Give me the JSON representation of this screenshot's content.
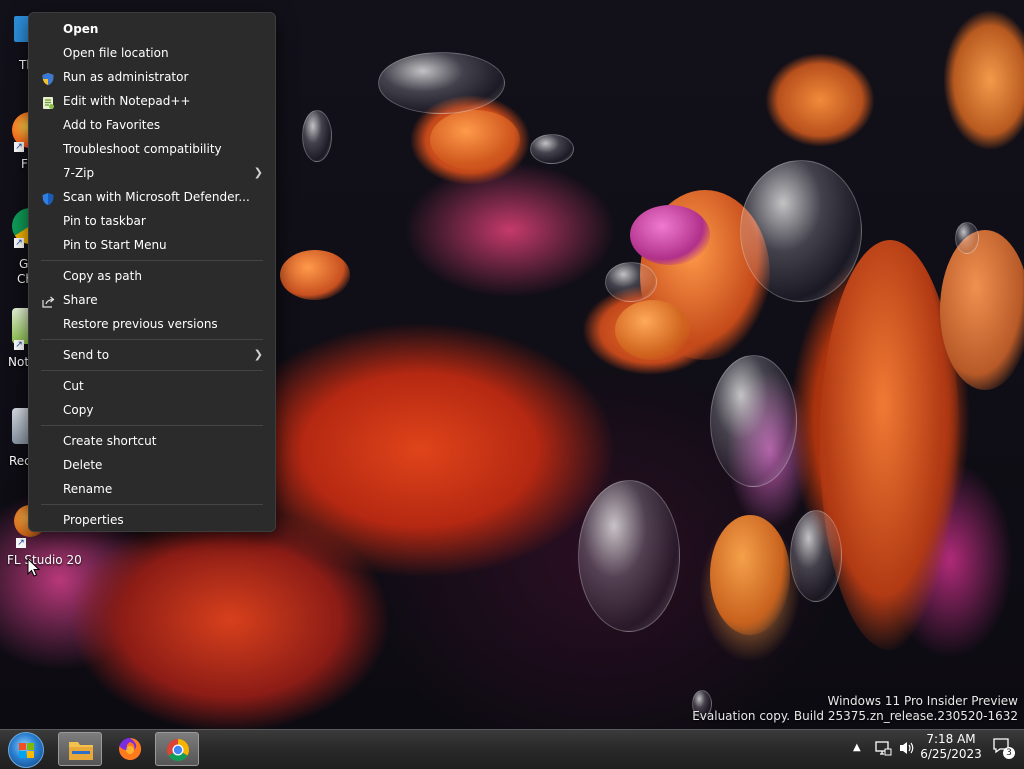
{
  "desktop": {
    "icons": [
      {
        "label": "Th"
      },
      {
        "label": "F"
      },
      {
        "label": "G"
      },
      {
        "label": "Ch"
      },
      {
        "label": "Not"
      },
      {
        "label": "Rec"
      },
      {
        "label": "FL Studio 20"
      }
    ]
  },
  "context_menu": {
    "items": [
      {
        "label": "Open",
        "icon": ""
      },
      {
        "label": "Open file location",
        "icon": ""
      },
      {
        "label": "Run as administrator",
        "icon": "uac-shield-icon"
      },
      {
        "label": "Edit with Notepad++",
        "icon": "notepadpp-icon"
      },
      {
        "label": "Add to Favorites",
        "icon": ""
      },
      {
        "label": "Troubleshoot compatibility",
        "icon": ""
      },
      {
        "label": "7-Zip",
        "icon": "",
        "submenu": true
      },
      {
        "label": "Scan with Microsoft Defender...",
        "icon": "defender-shield-icon"
      },
      {
        "label": "Pin to taskbar",
        "icon": ""
      },
      {
        "label": "Pin to Start Menu",
        "icon": ""
      },
      {
        "label": "Copy as path",
        "icon": ""
      },
      {
        "label": "Share",
        "icon": "share-icon"
      },
      {
        "label": "Restore previous versions",
        "icon": ""
      },
      {
        "label": "Send to",
        "icon": "",
        "submenu": true
      },
      {
        "label": "Cut",
        "icon": ""
      },
      {
        "label": "Copy",
        "icon": ""
      },
      {
        "label": "Create shortcut",
        "icon": ""
      },
      {
        "label": "Delete",
        "icon": ""
      },
      {
        "label": "Rename",
        "icon": ""
      },
      {
        "label": "Properties",
        "icon": ""
      }
    ],
    "colors": {
      "background": "#2b2b2b",
      "text": "#ffffff",
      "separator": "#454545"
    }
  },
  "watermark": {
    "line1": "Windows 11 Pro Insider Preview",
    "line2": "Evaluation copy. Build 25375.zn_release.230520-1632"
  },
  "taskbar": {
    "apps": [
      {
        "name": "file-explorer",
        "active": true
      },
      {
        "name": "firefox",
        "active": false
      },
      {
        "name": "chrome",
        "active": true
      }
    ],
    "clock": {
      "time": "7:18 AM",
      "date": "6/25/2023"
    },
    "notifications_count": "3"
  }
}
